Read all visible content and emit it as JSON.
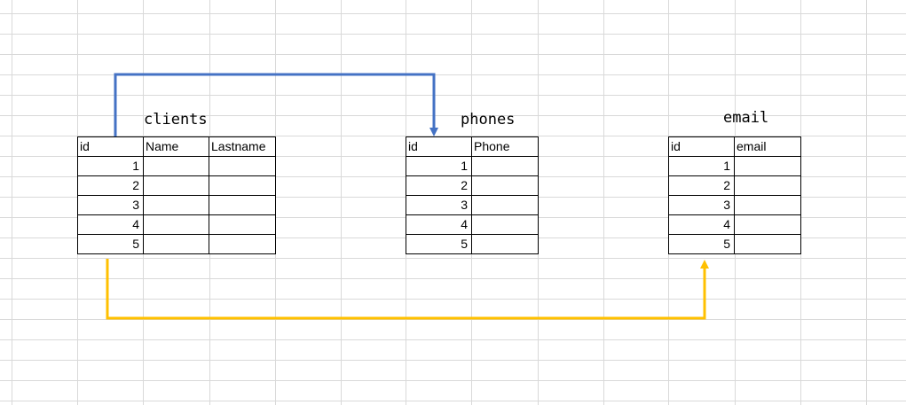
{
  "tables": {
    "clients": {
      "title": "clients",
      "headers": [
        "id",
        "Name",
        "Lastname"
      ],
      "ids": [
        "1",
        "2",
        "3",
        "4",
        "5"
      ]
    },
    "phones": {
      "title": "phones",
      "headers": [
        "id",
        "Phone"
      ],
      "ids": [
        "1",
        "2",
        "3",
        "4",
        "5"
      ]
    },
    "email": {
      "title": "email",
      "headers": [
        "id",
        "email"
      ],
      "ids": [
        "1",
        "2",
        "3",
        "4",
        "5"
      ]
    }
  },
  "connectors": {
    "clients_to_phones": {
      "color": "#4472C4"
    },
    "clients_to_email": {
      "color": "#FFC000"
    }
  },
  "gridline_color": "#D9D9D9"
}
